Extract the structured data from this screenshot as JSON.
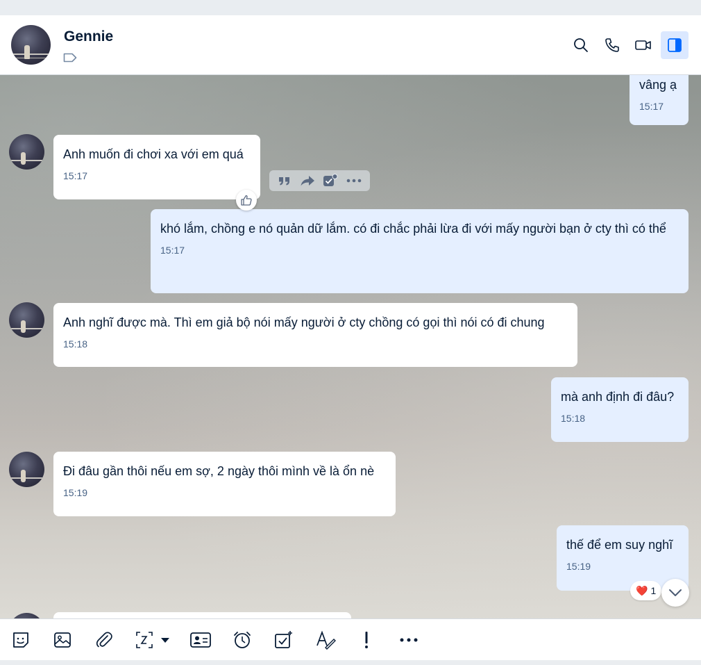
{
  "contact": {
    "name": "Gennie"
  },
  "header_icons": [
    "search-icon",
    "phone-icon",
    "video-camera-icon",
    "sidebar-toggle-icon"
  ],
  "messages": [
    {
      "side": "out",
      "text": "vâng ạ",
      "time": "15:17"
    },
    {
      "side": "in",
      "text": "Anh muốn đi chơi xa với em quá",
      "time": "15:17"
    },
    {
      "side": "out",
      "text": "khó lắm, chồng e nó quản dữ lắm. có đi chắc phải lừa đi với mấy người bạn ở cty thì có thể",
      "time": "15:17"
    },
    {
      "side": "in",
      "text": "Anh nghĩ được mà. Thì em giả bộ nói mấy người ở cty chồng có gọi thì nói có đi chung",
      "time": "15:18"
    },
    {
      "side": "out",
      "text": "mà anh định đi đâu?",
      "time": "15:18"
    },
    {
      "side": "in",
      "text": "Đi đâu gần thôi nếu em sợ, 2 ngày thôi mình về là ổn nè",
      "time": "15:19"
    },
    {
      "side": "out",
      "text": "thế để em suy nghĩ",
      "time": "15:19"
    }
  ],
  "reaction": {
    "emoji": "❤️",
    "count": "1"
  },
  "message_actions": [
    "quote-icon",
    "forward-icon",
    "add-task-icon",
    "more-icon"
  ],
  "toolbar": [
    "sticker-icon",
    "image-icon",
    "attachment-icon",
    "screenshot-icon",
    "contact-card-icon",
    "reminder-icon",
    "task-icon",
    "format-text-icon",
    "urgent-icon",
    "more-icon"
  ],
  "colors": {
    "accent": "#0068ff",
    "bubble_out": "#e5efff",
    "bubble_in": "#ffffff",
    "time": "#476285"
  }
}
